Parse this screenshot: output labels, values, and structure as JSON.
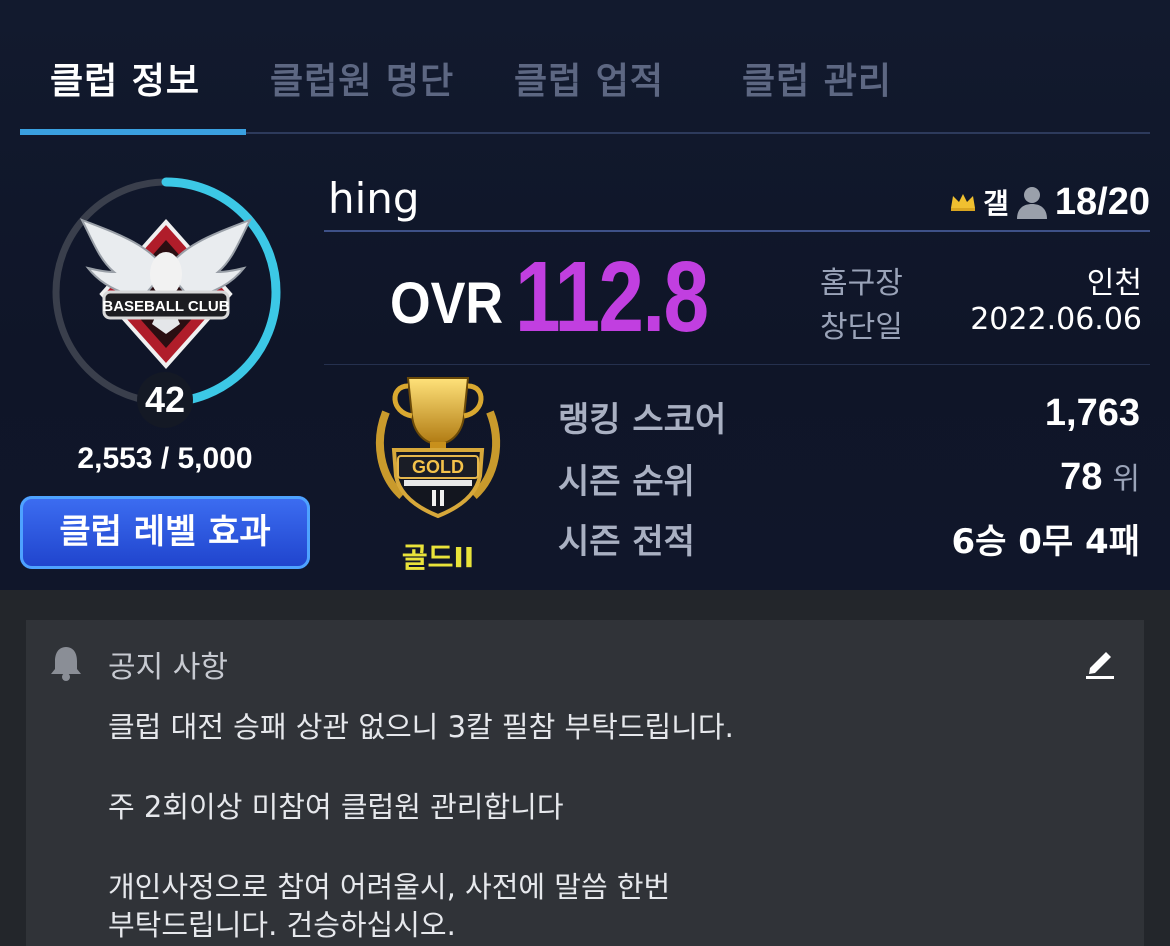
{
  "tabs": [
    {
      "label": "클럽 정보",
      "active": true
    },
    {
      "label": "클럽원 명단",
      "active": false
    },
    {
      "label": "클럽 업적",
      "active": false
    },
    {
      "label": "클럽 관리",
      "active": false
    }
  ],
  "club": {
    "name": "hing",
    "leader": "갤",
    "members": "18/20",
    "emblem_text": "BASEBALL CLUB",
    "level": "42",
    "xp": "2,553 / 5,000",
    "xp_fraction": 0.51,
    "level_button": "클럽 레벨 효과",
    "ovr_label": "OVR",
    "ovr_value": "112.8",
    "home_label": "홈구장",
    "home_value": "인천",
    "founded_label": "창단일",
    "founded_value": "2022.06.06"
  },
  "rank": {
    "emblem_text": "GOLD",
    "tier_name": "골드II",
    "score_label": "랭킹 스코어",
    "score_value": "1,763",
    "season_rank_label": "시즌 순위",
    "season_rank_value": "78",
    "season_rank_unit": "위",
    "season_record_label": "시즌 전적",
    "season_record_value": "6승 0무 4패"
  },
  "notice": {
    "title": "공지 사항",
    "lines": [
      "클럽 대전 승패 상관 없으니 3칼 필참 부탁드립니다.",
      "주 2회이상 미참여 클럽원 관리합니다",
      "개인사정으로 참여 어려울시, 사전에 말씀 한번",
      "부탁드립니다. 건승하십시오."
    ]
  },
  "colors": {
    "ovr": "#c13fe0",
    "tab_underline": "#3aa0e0",
    "level_ring": "#3cc8e6",
    "tier_name": "#e9e33a",
    "button": "#2a55e0"
  }
}
